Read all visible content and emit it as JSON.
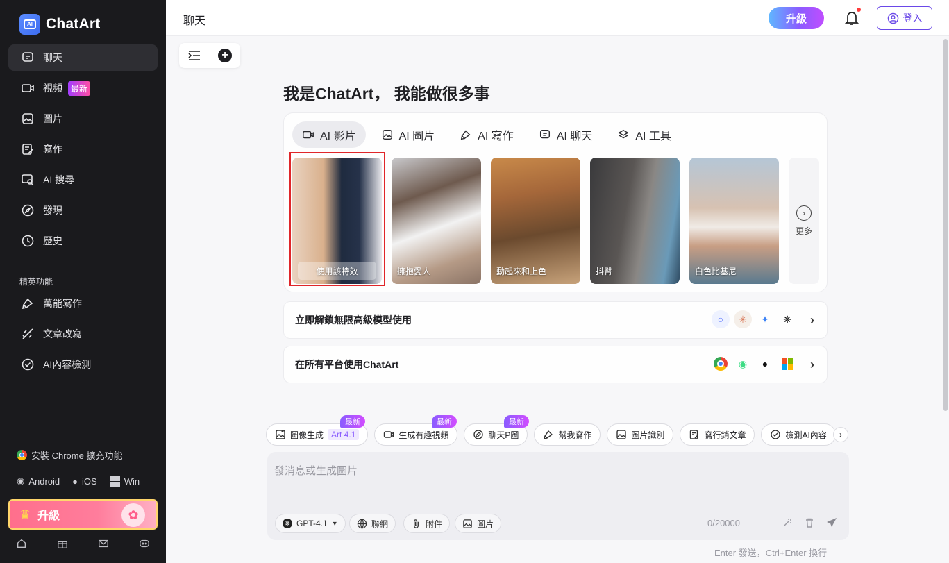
{
  "app": {
    "name": "ChatArt"
  },
  "sidebar": {
    "items": [
      {
        "label": "聊天",
        "icon": "chat-icon"
      },
      {
        "label": "視頻",
        "icon": "video-icon",
        "badge": "最新"
      },
      {
        "label": "圖片",
        "icon": "image-icon"
      },
      {
        "label": "寫作",
        "icon": "write-icon"
      },
      {
        "label": "AI 搜尋",
        "icon": "ai-search-icon"
      },
      {
        "label": "發現",
        "icon": "compass-icon"
      },
      {
        "label": "歷史",
        "icon": "history-icon"
      }
    ],
    "section_label": "精英功能",
    "elite_items": [
      {
        "label": "萬能寫作",
        "icon": "pen-icon"
      },
      {
        "label": "文章改寫",
        "icon": "rewrite-icon"
      },
      {
        "label": "AI內容檢測",
        "icon": "check-icon"
      }
    ],
    "chrome_ext": "安裝 Chrome 擴充功能",
    "platforms": {
      "android": "Android",
      "ios": "iOS",
      "win": "Win"
    },
    "upgrade_label": "升級"
  },
  "header": {
    "title": "聊天",
    "upgrade_label": "升級",
    "login_label": "登入"
  },
  "main": {
    "heading": "我是ChatArt， 我能做很多事",
    "tabs": [
      {
        "label": "AI 影片",
        "icon": "video-icon"
      },
      {
        "label": "AI 圖片",
        "icon": "image-icon"
      },
      {
        "label": "AI 寫作",
        "icon": "pen-icon"
      },
      {
        "label": "AI 聊天",
        "icon": "chat-icon"
      },
      {
        "label": "AI 工具",
        "icon": "layers-icon"
      }
    ],
    "thumbnails": [
      {
        "caption": "使用該特效"
      },
      {
        "caption": "擁抱愛人"
      },
      {
        "caption": "動起來和上色"
      },
      {
        "caption": "抖臀"
      },
      {
        "caption": "白色比基尼"
      }
    ],
    "more_label": "更多",
    "banner_models": "立即解鎖無限高級模型使用",
    "banner_platforms": "在所有平台使用ChatArt"
  },
  "chips": [
    {
      "label": "圖像生成",
      "extra": "Art 4.1",
      "tag": "最新",
      "icon": "image-gen-icon"
    },
    {
      "label": "生成有趣視頻",
      "tag": "最新",
      "icon": "video-icon"
    },
    {
      "label": "聊天P圖",
      "tag": "最新",
      "icon": "chat-edit-icon"
    },
    {
      "label": "幫我寫作",
      "icon": "pen-icon"
    },
    {
      "label": "圖片識別",
      "icon": "image-scan-icon"
    },
    {
      "label": "寫行銷文章",
      "icon": "doc-icon"
    },
    {
      "label": "檢測AI內容",
      "icon": "check-icon"
    }
  ],
  "input": {
    "placeholder": "發消息或生成圖片",
    "model": "GPT-4.1",
    "web_label": "聯網",
    "attach_label": "附件",
    "image_label": "圖片",
    "counter": "0/20000",
    "hint": "Enter 發送，Ctrl+Enter 換行"
  }
}
